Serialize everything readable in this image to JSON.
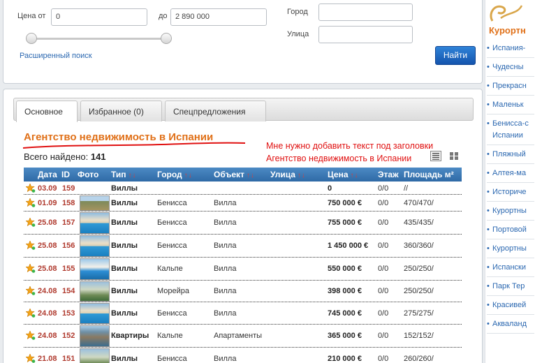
{
  "search": {
    "price_from_label": "Цена от",
    "price_from_value": "0",
    "price_to_label": "до",
    "price_to_value": "2 890 000",
    "city_label": "Город",
    "city_value": "",
    "street_label": "Улица",
    "street_value": "",
    "advanced_link": "Расширенный поиск",
    "find_button": "Найти"
  },
  "tabs": [
    {
      "label": "Основное",
      "active": true
    },
    {
      "label": "Избранное (0)",
      "active": false
    },
    {
      "label": "Спецпредложения",
      "active": false
    }
  ],
  "main": {
    "title": "Агентство недвижимость в Испании",
    "annotation_line1": "Мне нужно добавить текст под заголовки",
    "annotation_line2": "Агентство недвижимость в Испании",
    "total_label": "Всего найдено:",
    "total_count": "141"
  },
  "table": {
    "headers": {
      "date": "Дата",
      "id": "ID",
      "photo": "Фото",
      "type": "Тип",
      "city": "Город",
      "object": "Объект",
      "street": "Улица",
      "price": "Цена",
      "floor": "Этаж",
      "area": "Площадь м²"
    },
    "sort_arrows": "↑↓",
    "rows": [
      {
        "date": "03.09",
        "id": "159",
        "type": "Виллы",
        "city": "",
        "object": "",
        "price": "0",
        "floor": "0/0",
        "area": "//",
        "photo": "none"
      },
      {
        "date": "01.09",
        "id": "158",
        "type": "Виллы",
        "city": "Бенисса",
        "object": "Вилла",
        "price": "750 000 €",
        "floor": "0/0",
        "area": "470/470/",
        "photo": "land"
      },
      {
        "date": "25.08",
        "id": "157",
        "type": "Виллы",
        "city": "Бенисса",
        "object": "Вилла",
        "price": "755 000 €",
        "floor": "0/0",
        "area": "435/435/",
        "photo": "pool"
      },
      {
        "date": "25.08",
        "id": "156",
        "type": "Виллы",
        "city": "Бенисса",
        "object": "Вилла",
        "price": "1 450 000 €",
        "floor": "0/0",
        "area": "360/360/",
        "photo": "pool"
      },
      {
        "date": "25.08",
        "id": "155",
        "type": "Виллы",
        "city": "Кальпе",
        "object": "Вилла",
        "price": "550 000 €",
        "floor": "0/0",
        "area": "250/250/",
        "photo": "sea"
      },
      {
        "date": "24.08",
        "id": "154",
        "type": "Виллы",
        "city": "Морейра",
        "object": "Вилла",
        "price": "398 000 €",
        "floor": "0/0",
        "area": "250/250/",
        "photo": "house"
      },
      {
        "date": "24.08",
        "id": "153",
        "type": "Виллы",
        "city": "Бенисса",
        "object": "Вилла",
        "price": "745 000 €",
        "floor": "0/0",
        "area": "275/275/",
        "photo": "pool"
      },
      {
        "date": "24.08",
        "id": "152",
        "type": "Квартиры",
        "city": "Кальпе",
        "object": "Апартаменты",
        "price": "365 000 €",
        "floor": "0/0",
        "area": "152/152/",
        "photo": "coast"
      },
      {
        "date": "21.08",
        "id": "151",
        "type": "Виллы",
        "city": "Бенисса",
        "object": "Вилла",
        "price": "210 000 €",
        "floor": "0/0",
        "area": "260/260/",
        "photo": "house"
      }
    ]
  },
  "sidebar": {
    "title": "Курортн",
    "items": [
      "Испания-",
      "Чудесны",
      "Прекрасн",
      "Маленьк",
      "Бенисса-с",
      "Испании",
      "Пляжный",
      "Алтея-ма",
      "Историче",
      "Курортны",
      "Портовой",
      "Курортны",
      "Испански",
      "Парк Тер",
      "Красивей",
      "Акваланд"
    ]
  },
  "colors": {
    "accent_orange": "#e07018",
    "link_blue": "#2a67b0",
    "header_blue": "#3a78b4",
    "annotation_red": "#e01010",
    "id_red": "#b03a2e"
  }
}
